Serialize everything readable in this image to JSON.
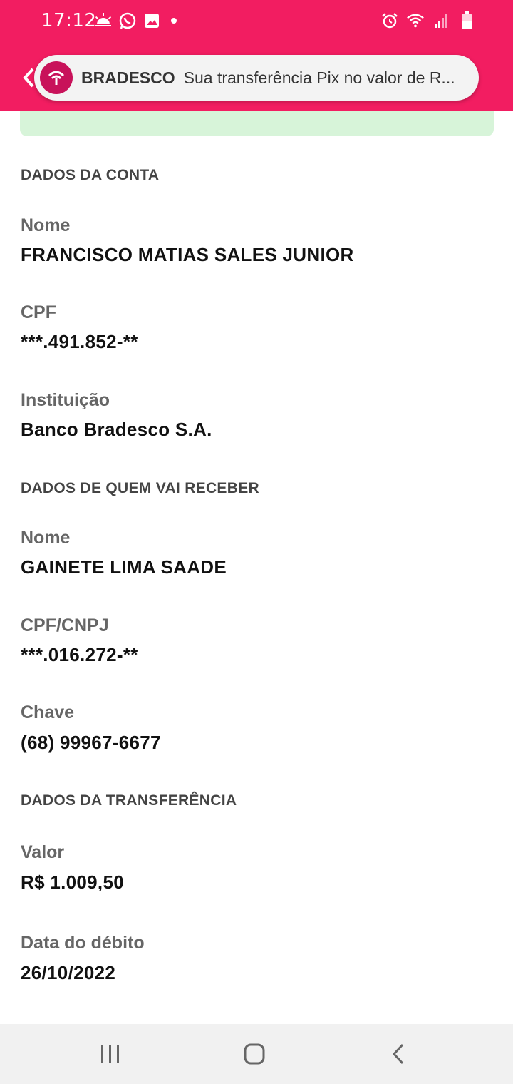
{
  "status_bar": {
    "time": "17:12",
    "left_icons": [
      "weather-icon",
      "whatsapp-icon",
      "gallery-icon",
      "dot-icon"
    ],
    "right_icons": [
      "alarm-icon",
      "wifi-icon",
      "signal-icon",
      "battery-icon"
    ],
    "background_color": "#f21d61"
  },
  "notification": {
    "app_name": "BRADESCO",
    "text": "Sua transferência Pix no valor de R..."
  },
  "sections": {
    "account": {
      "title": "DADOS DA CONTA",
      "name_label": "Nome",
      "name_value": "FRANCISCO MATIAS SALES JUNIOR",
      "cpf_label": "CPF",
      "cpf_value": "***.491.852-**",
      "institution_label": "Instituição",
      "institution_value": "Banco Bradesco S.A."
    },
    "receiver": {
      "title": "DADOS DE QUEM VAI RECEBER",
      "name_label": "Nome",
      "name_value": "GAINETE LIMA SAADE",
      "doc_label": "CPF/CNPJ",
      "doc_value": "***.016.272-**",
      "key_label": "Chave",
      "key_value": "(68) 99967-6677"
    },
    "transfer": {
      "title": "DADOS DA TRANSFERÊNCIA",
      "amount_label": "Valor",
      "amount_value": "R$ 1.009,50",
      "date_label": "Data do débito",
      "date_value": "26/10/2022"
    }
  },
  "nav_bar": {
    "buttons": [
      "recent-apps-icon",
      "home-icon",
      "back-icon"
    ]
  }
}
